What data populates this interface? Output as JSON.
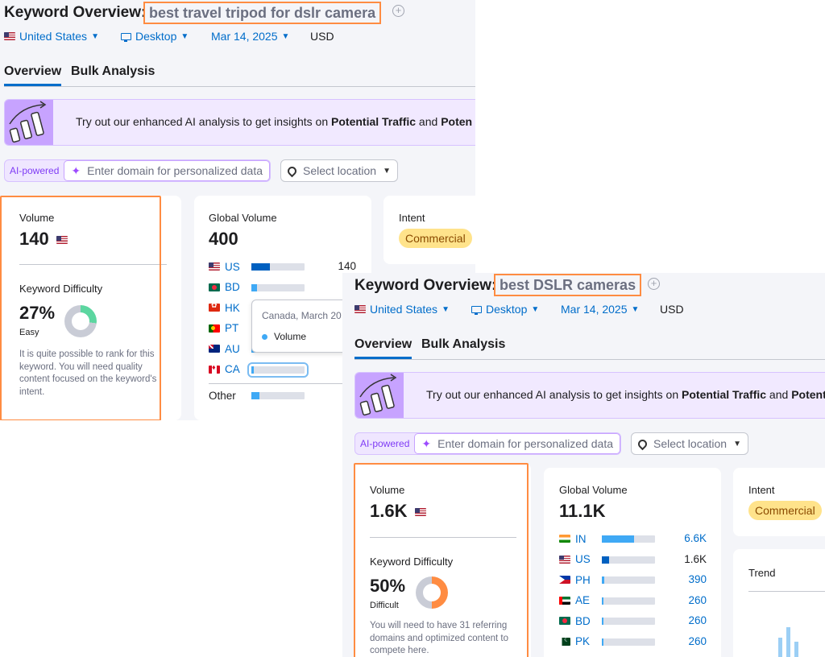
{
  "panel1": {
    "title": "Keyword Overview:",
    "keyword": "best travel tripod for dslr camera",
    "filters": {
      "country": "United States",
      "device": "Desktop",
      "date": "Mar 14, 2025",
      "currency": "USD"
    },
    "tabs": [
      "Overview",
      "Bulk Analysis"
    ],
    "banner_prefix": "Try out our enhanced AI analysis to get insights on ",
    "banner_bold1": "Potential Traffic",
    "banner_and": " and ",
    "banner_bold2": "Poten",
    "ai_label": "AI-powered",
    "domain_placeholder": "Enter domain for personalized data",
    "location_placeholder": "Select location",
    "volume_label": "Volume",
    "volume": "140",
    "kd_label": "Keyword Difficulty",
    "kd_value": "27%",
    "kd_percent": 27,
    "kd_level": "Easy",
    "kd_desc": "It is quite possible to rank for this keyword. You will need quality content focused on the keyword's intent.",
    "global_label": "Global Volume",
    "global_value": "400",
    "countries": [
      {
        "code": "US",
        "flag": "us",
        "fill": 0.35,
        "value": "140"
      },
      {
        "code": "BD",
        "flag": "bd",
        "fill": 0.1,
        "value": ""
      },
      {
        "code": "HK",
        "flag": "hk",
        "fill": 0.1,
        "value": ""
      },
      {
        "code": "PT",
        "flag": "pt",
        "fill": 0.1,
        "value": ""
      },
      {
        "code": "AU",
        "flag": "au",
        "fill": 0.1,
        "value": ""
      },
      {
        "code": "CA",
        "flag": "ca",
        "fill": 0.05,
        "value": ""
      }
    ],
    "other_label": "Other",
    "other_fill": 0.15,
    "tooltip_title": "Canada, March 20",
    "tooltip_series": "Volume",
    "intent_label": "Intent",
    "intent_value": "Commercial"
  },
  "panel2": {
    "title": "Keyword Overview:",
    "keyword": "best DSLR cameras",
    "filters": {
      "country": "United States",
      "device": "Desktop",
      "date": "Mar 14, 2025",
      "currency": "USD"
    },
    "tabs": [
      "Overview",
      "Bulk Analysis"
    ],
    "banner_prefix": "Try out our enhanced AI analysis to get insights on ",
    "banner_bold1": "Potential Traffic",
    "banner_and": " and ",
    "banner_bold2": "Potent",
    "ai_label": "AI-powered",
    "domain_placeholder": "Enter domain for personalized data",
    "location_placeholder": "Select location",
    "volume_label": "Volume",
    "volume": "1.6K",
    "kd_label": "Keyword Difficulty",
    "kd_value": "50%",
    "kd_percent": 50,
    "kd_level": "Difficult",
    "kd_desc": "You will need to have 31 referring domains and optimized content to compete here.",
    "global_label": "Global Volume",
    "global_value": "11.1K",
    "countries": [
      {
        "code": "IN",
        "flag": "in",
        "fill": 0.6,
        "value": "6.6K",
        "link": true
      },
      {
        "code": "US",
        "flag": "us",
        "fill": 0.14,
        "value": "1.6K",
        "link": false
      },
      {
        "code": "PH",
        "flag": "ph",
        "fill": 0.04,
        "value": "390",
        "link": true
      },
      {
        "code": "AE",
        "flag": "ae",
        "fill": 0.03,
        "value": "260",
        "link": true
      },
      {
        "code": "BD",
        "flag": "bd",
        "fill": 0.03,
        "value": "260",
        "link": true
      },
      {
        "code": "PK",
        "flag": "pk",
        "fill": 0.03,
        "value": "260",
        "link": true
      }
    ],
    "intent_label": "Intent",
    "intent_value": "Commercial",
    "trend_label": "Trend"
  },
  "colors": {
    "accent": "#006dca",
    "highlight": "#ff8c42",
    "bar_light": "#3fa9f5",
    "bar_dark": "#0060c0",
    "kd_easy": "#5cd6a0",
    "kd_difficult": "#ff8c42",
    "intent_bg": "#ffe38b"
  }
}
